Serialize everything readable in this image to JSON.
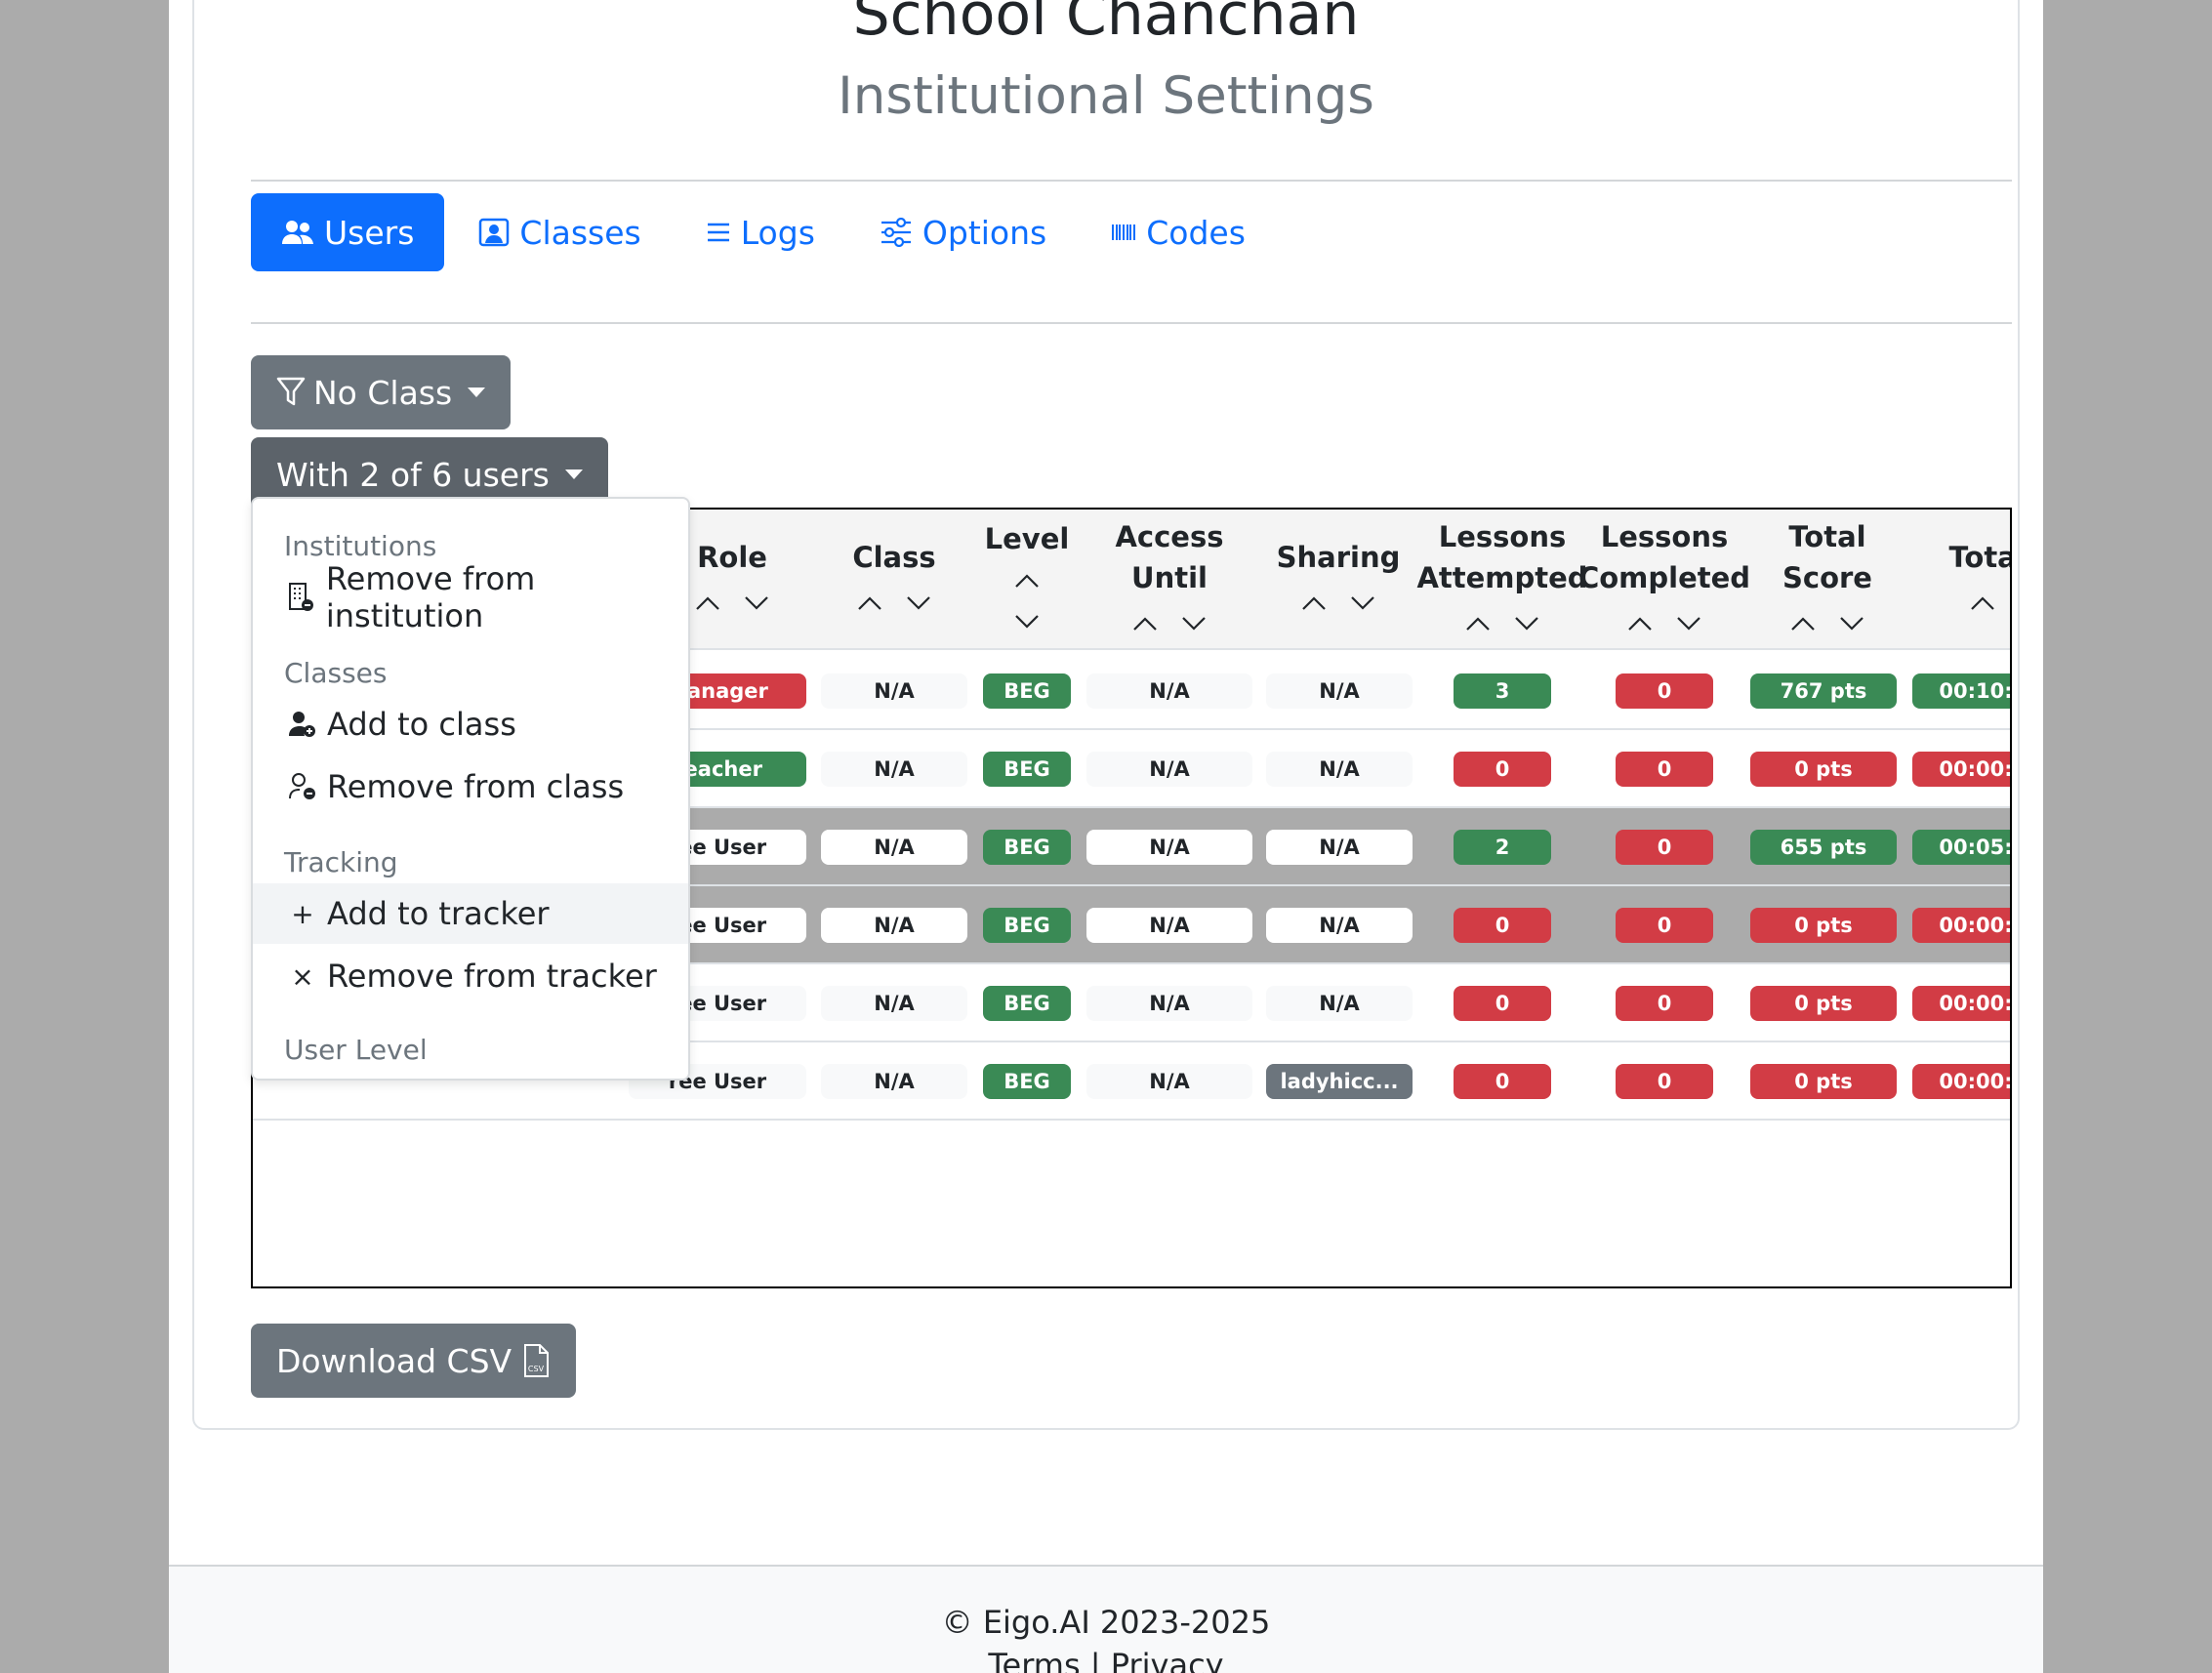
{
  "header": {
    "school": "School Chanchan",
    "subtitle": "Institutional Settings"
  },
  "tabs": [
    {
      "label": "Users",
      "icon": "users-icon",
      "active": true
    },
    {
      "label": "Classes",
      "icon": "person-badge-icon"
    },
    {
      "label": "Logs",
      "icon": "list-icon"
    },
    {
      "label": "Options",
      "icon": "sliders-icon"
    },
    {
      "label": "Codes",
      "icon": "barcode-icon"
    }
  ],
  "filters": {
    "class_label": "No Class",
    "users_label": "With 2 of 6 users"
  },
  "table": {
    "columns": [
      "Role",
      "Class",
      "Level",
      "Access Until",
      "Sharing",
      "Lessons Attempted",
      "Lessons Completed",
      "Total Score",
      "Total Ti"
    ],
    "rows": [
      {
        "role": "Manager",
        "class": "N/A",
        "level": "BEG",
        "access": "N/A",
        "sharing": "N/A",
        "attempted": "3",
        "completed": "0",
        "score": "767 pts",
        "time": "00:10:",
        "shaded": false
      },
      {
        "role": "Teacher",
        "class": "N/A",
        "level": "BEG",
        "access": "N/A",
        "sharing": "N/A",
        "attempted": "0",
        "completed": "0",
        "score": "0 pts",
        "time": "00:00:",
        "shaded": false
      },
      {
        "role": "ree User",
        "class": "N/A",
        "level": "BEG",
        "access": "N/A",
        "sharing": "N/A",
        "attempted": "2",
        "completed": "0",
        "score": "655 pts",
        "time": "00:05:",
        "shaded": true
      },
      {
        "role": "ree User",
        "class": "N/A",
        "level": "BEG",
        "access": "N/A",
        "sharing": "N/A",
        "attempted": "0",
        "completed": "0",
        "score": "0 pts",
        "time": "00:00:",
        "shaded": true
      },
      {
        "role": "ree User",
        "class": "N/A",
        "level": "BEG",
        "access": "N/A",
        "sharing": "N/A",
        "attempted": "0",
        "completed": "0",
        "score": "0 pts",
        "time": "00:00:",
        "shaded": false
      },
      {
        "role": "ree User",
        "class": "N/A",
        "level": "BEG",
        "access": "N/A",
        "sharing": "ladyhicc...",
        "attempted": "0",
        "completed": "0",
        "score": "0 pts",
        "time": "00:00:",
        "shaded": false
      }
    ]
  },
  "dropdown": {
    "institutions_header": "Institutions",
    "remove_institution": "Remove from institution",
    "classes_header": "Classes",
    "add_class": "Add to class",
    "remove_class": "Remove from class",
    "tracking_header": "Tracking",
    "add_tracker": "Add to tracker",
    "remove_tracker": "Remove from tracker",
    "user_level_header": "User Level"
  },
  "download": {
    "label": "Download CSV"
  },
  "footer": {
    "copyright": "© Eigo.AI 2023-2025",
    "terms": "Terms",
    "separator": " | ",
    "privacy": "Privacy"
  },
  "colors": {
    "primary": "#0d6efd",
    "success": "#3a8a55",
    "danger": "#d23c45",
    "secondary": "#6c757d"
  }
}
